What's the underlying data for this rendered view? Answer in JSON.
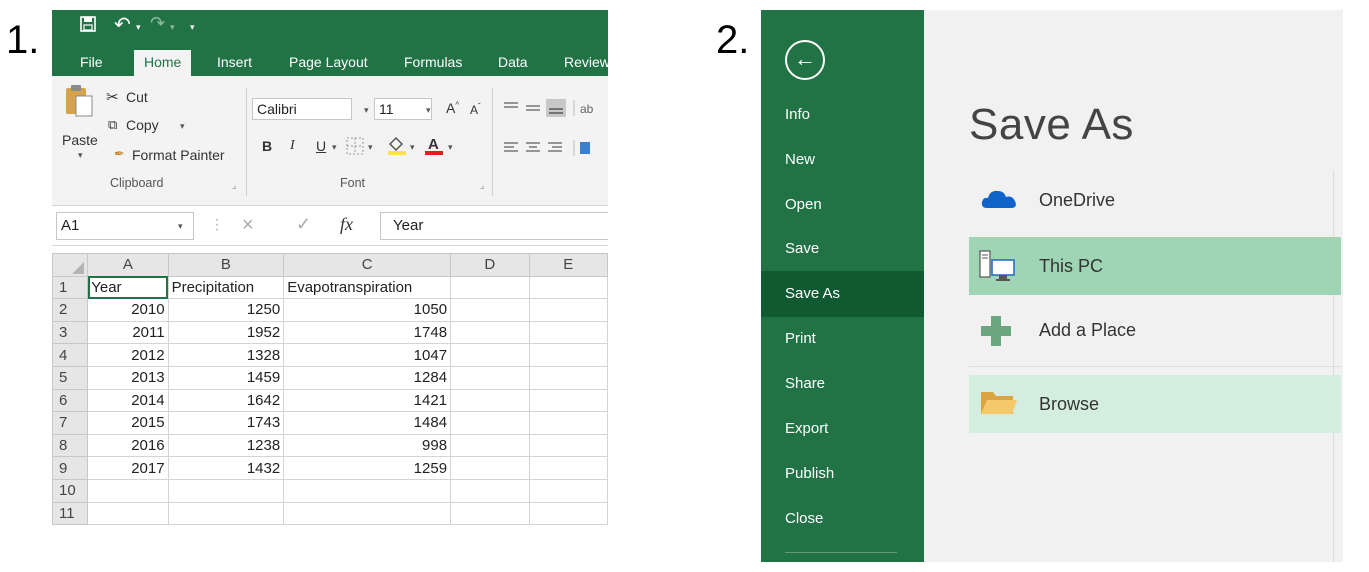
{
  "step_labels": {
    "one": "1.",
    "two": "2."
  },
  "excel": {
    "tabs": [
      "File",
      "Home",
      "Insert",
      "Page Layout",
      "Formulas",
      "Data",
      "Review"
    ],
    "active_tab": "Home",
    "clipboard": {
      "paste": "Paste",
      "cut": "Cut",
      "copy": "Copy",
      "format_painter": "Format Painter",
      "group_name": "Clipboard"
    },
    "font": {
      "name": "Calibri",
      "size": "11",
      "group_name": "Font",
      "bold": "B",
      "italic": "I",
      "underline": "U"
    },
    "formula_bar": {
      "name_box": "A1",
      "fx": "fx",
      "content": "Year"
    },
    "columns": [
      "A",
      "B",
      "C",
      "D",
      "E"
    ],
    "rows": [
      [
        "1",
        "Year",
        "Precipitation",
        "Evapotranspiration",
        "",
        ""
      ],
      [
        "2",
        "2010",
        "1250",
        "1050",
        "",
        ""
      ],
      [
        "3",
        "2011",
        "1952",
        "1748",
        "",
        ""
      ],
      [
        "4",
        "2012",
        "1328",
        "1047",
        "",
        ""
      ],
      [
        "5",
        "2013",
        "1459",
        "1284",
        "",
        ""
      ],
      [
        "6",
        "2014",
        "1642",
        "1421",
        "",
        ""
      ],
      [
        "7",
        "2015",
        "1743",
        "1484",
        "",
        ""
      ],
      [
        "8",
        "2016",
        "1238",
        "998",
        "",
        ""
      ],
      [
        "9",
        "2017",
        "1432",
        "1259",
        "",
        ""
      ],
      [
        "10",
        "",
        "",
        "",
        "",
        ""
      ],
      [
        "11",
        "",
        "",
        "",
        "",
        ""
      ]
    ],
    "colors": {
      "accent": "#217346",
      "ribbon_bg": "#f3f3f3"
    }
  },
  "backstage": {
    "title": "Save As",
    "nav": [
      "Info",
      "New",
      "Open",
      "Save",
      "Save As",
      "Print",
      "Share",
      "Export",
      "Publish",
      "Close"
    ],
    "active_nav": "Save As",
    "locations": [
      {
        "label": "OneDrive",
        "icon": "cloud-icon"
      },
      {
        "label": "This PC",
        "icon": "computer-icon"
      },
      {
        "label": "Add a Place",
        "icon": "plus-icon"
      },
      {
        "label": "Browse",
        "icon": "folder-icon"
      }
    ],
    "colors": {
      "nav_bg": "#217346",
      "nav_active": "#0f5a30",
      "selected": "#9fd5b4",
      "hover": "#d3eddf"
    }
  }
}
